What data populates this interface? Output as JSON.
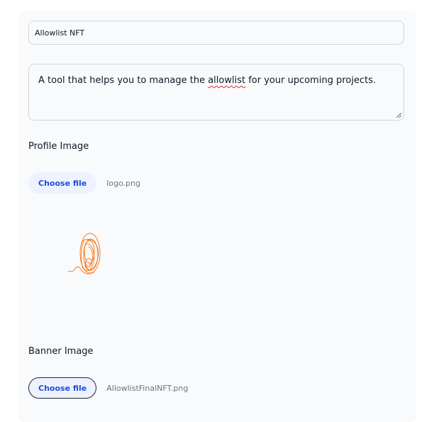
{
  "form": {
    "name_value": "Allowlist NFT",
    "description": {
      "before": "A tool that helps you to manage the ",
      "misspelled": "allowlist",
      "after": " for your upcoming projects."
    },
    "profile_image": {
      "label": "Profile Image",
      "button_label": "Choose file",
      "file_name": "logo.png",
      "preview_icon": "scribble-logo-icon",
      "stroke_color": "#f97316"
    },
    "banner_image": {
      "label": "Banner Image",
      "button_label": "Choose file",
      "file_name": "AllowlistFinalNFT.png"
    }
  },
  "colors": {
    "accent": "#1d4ed8",
    "button_bg": "#eef2ff",
    "card_bg": "#f9fafb",
    "border": "#d1d5db"
  }
}
